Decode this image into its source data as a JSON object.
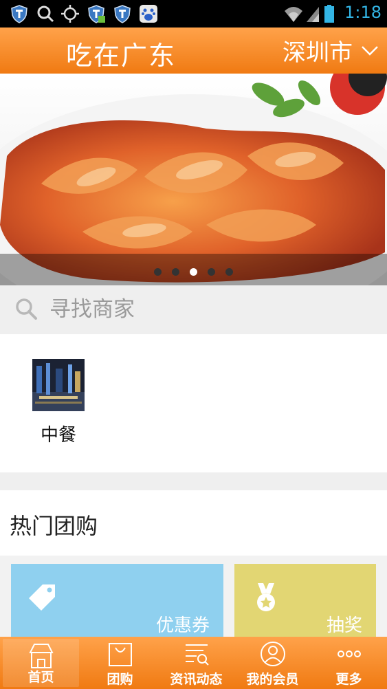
{
  "status_bar": {
    "time": "1:18",
    "icons": [
      "shield-icon",
      "search-icon",
      "gps-icon",
      "shield-icon",
      "shield-icon",
      "baidu-icon",
      "wifi-icon",
      "signal-icon",
      "battery-icon"
    ]
  },
  "header": {
    "title": "吃在广东",
    "city": "深圳市"
  },
  "banner": {
    "slide_count": 5,
    "active_index": 2
  },
  "search": {
    "placeholder": "寻找商家"
  },
  "categories": [
    {
      "label": "中餐"
    }
  ],
  "hot_deals": {
    "title": "热门团购",
    "cards": [
      {
        "label": "优惠券",
        "icon": "tag-icon",
        "color": "#8fd0ef"
      },
      {
        "label": "抽奖",
        "icon": "medal-icon",
        "color": "#e2d673"
      }
    ]
  },
  "bottom_nav": {
    "items": [
      {
        "label": "首页",
        "icon": "home-icon",
        "active": true
      },
      {
        "label": "团购",
        "icon": "bag-icon",
        "active": false
      },
      {
        "label": "资讯动态",
        "icon": "news-icon",
        "active": false
      },
      {
        "label": "我的会员",
        "icon": "user-icon",
        "active": false
      },
      {
        "label": "更多",
        "icon": "more-icon",
        "active": false
      }
    ]
  },
  "colors": {
    "accent": "#f58a22",
    "status_time": "#33b5e5"
  }
}
